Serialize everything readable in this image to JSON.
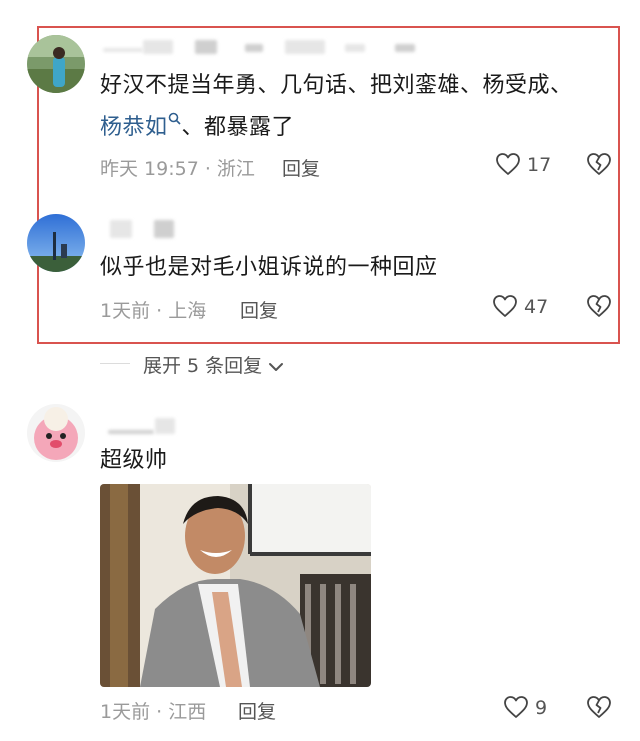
{
  "comments": [
    {
      "text_line1": "好汉不提当年勇、几句话、把刘銮雄、杨受成、",
      "link_text": "杨恭如",
      "text_line2_rest": "、都暴露了",
      "time": "昨天 19:57 · 浙江",
      "reply_label": "回复",
      "likes": "17"
    },
    {
      "text": "似乎也是对毛小姐诉说的一种回应",
      "time": "1天前 · 上海",
      "reply_label": "回复",
      "likes": "47"
    },
    {
      "text": "超级帅",
      "time": "1天前 · 江西",
      "reply_label": "回复",
      "likes": "9"
    }
  ],
  "expand_replies_label": "展开 5 条回复",
  "colors": {
    "highlight_border": "#d9534f",
    "link": "#2f5f8f"
  },
  "icons": [
    "search-icon",
    "heart-icon",
    "broken-heart-icon",
    "chevron-down-icon"
  ]
}
